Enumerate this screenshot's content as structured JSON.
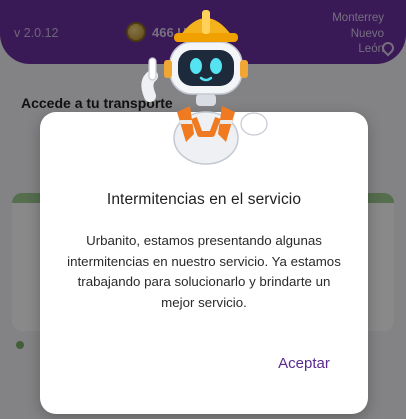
{
  "header": {
    "version": "v 2.0.12",
    "coins_text": "466 Urbans",
    "location": "Monterrey\nNuevo\nLeón"
  },
  "main": {
    "section_title": "Accede a tu transporte"
  },
  "dialog": {
    "title": "Intermitencias en el servicio",
    "message": "Urbanito, estamos presentando algunas intermitencias en nuestro servicio. Ya estamos trabajando para solucionarlo y brindarte un mejor servicio.",
    "accept_label": "Aceptar"
  },
  "colors": {
    "brand_purple": "#6a2f9e",
    "accept_text": "#5a2a91",
    "card_stripe": "#9cc98e"
  },
  "icons": [
    "coin-icon",
    "location-pin-icon",
    "robot-mascot-icon"
  ]
}
